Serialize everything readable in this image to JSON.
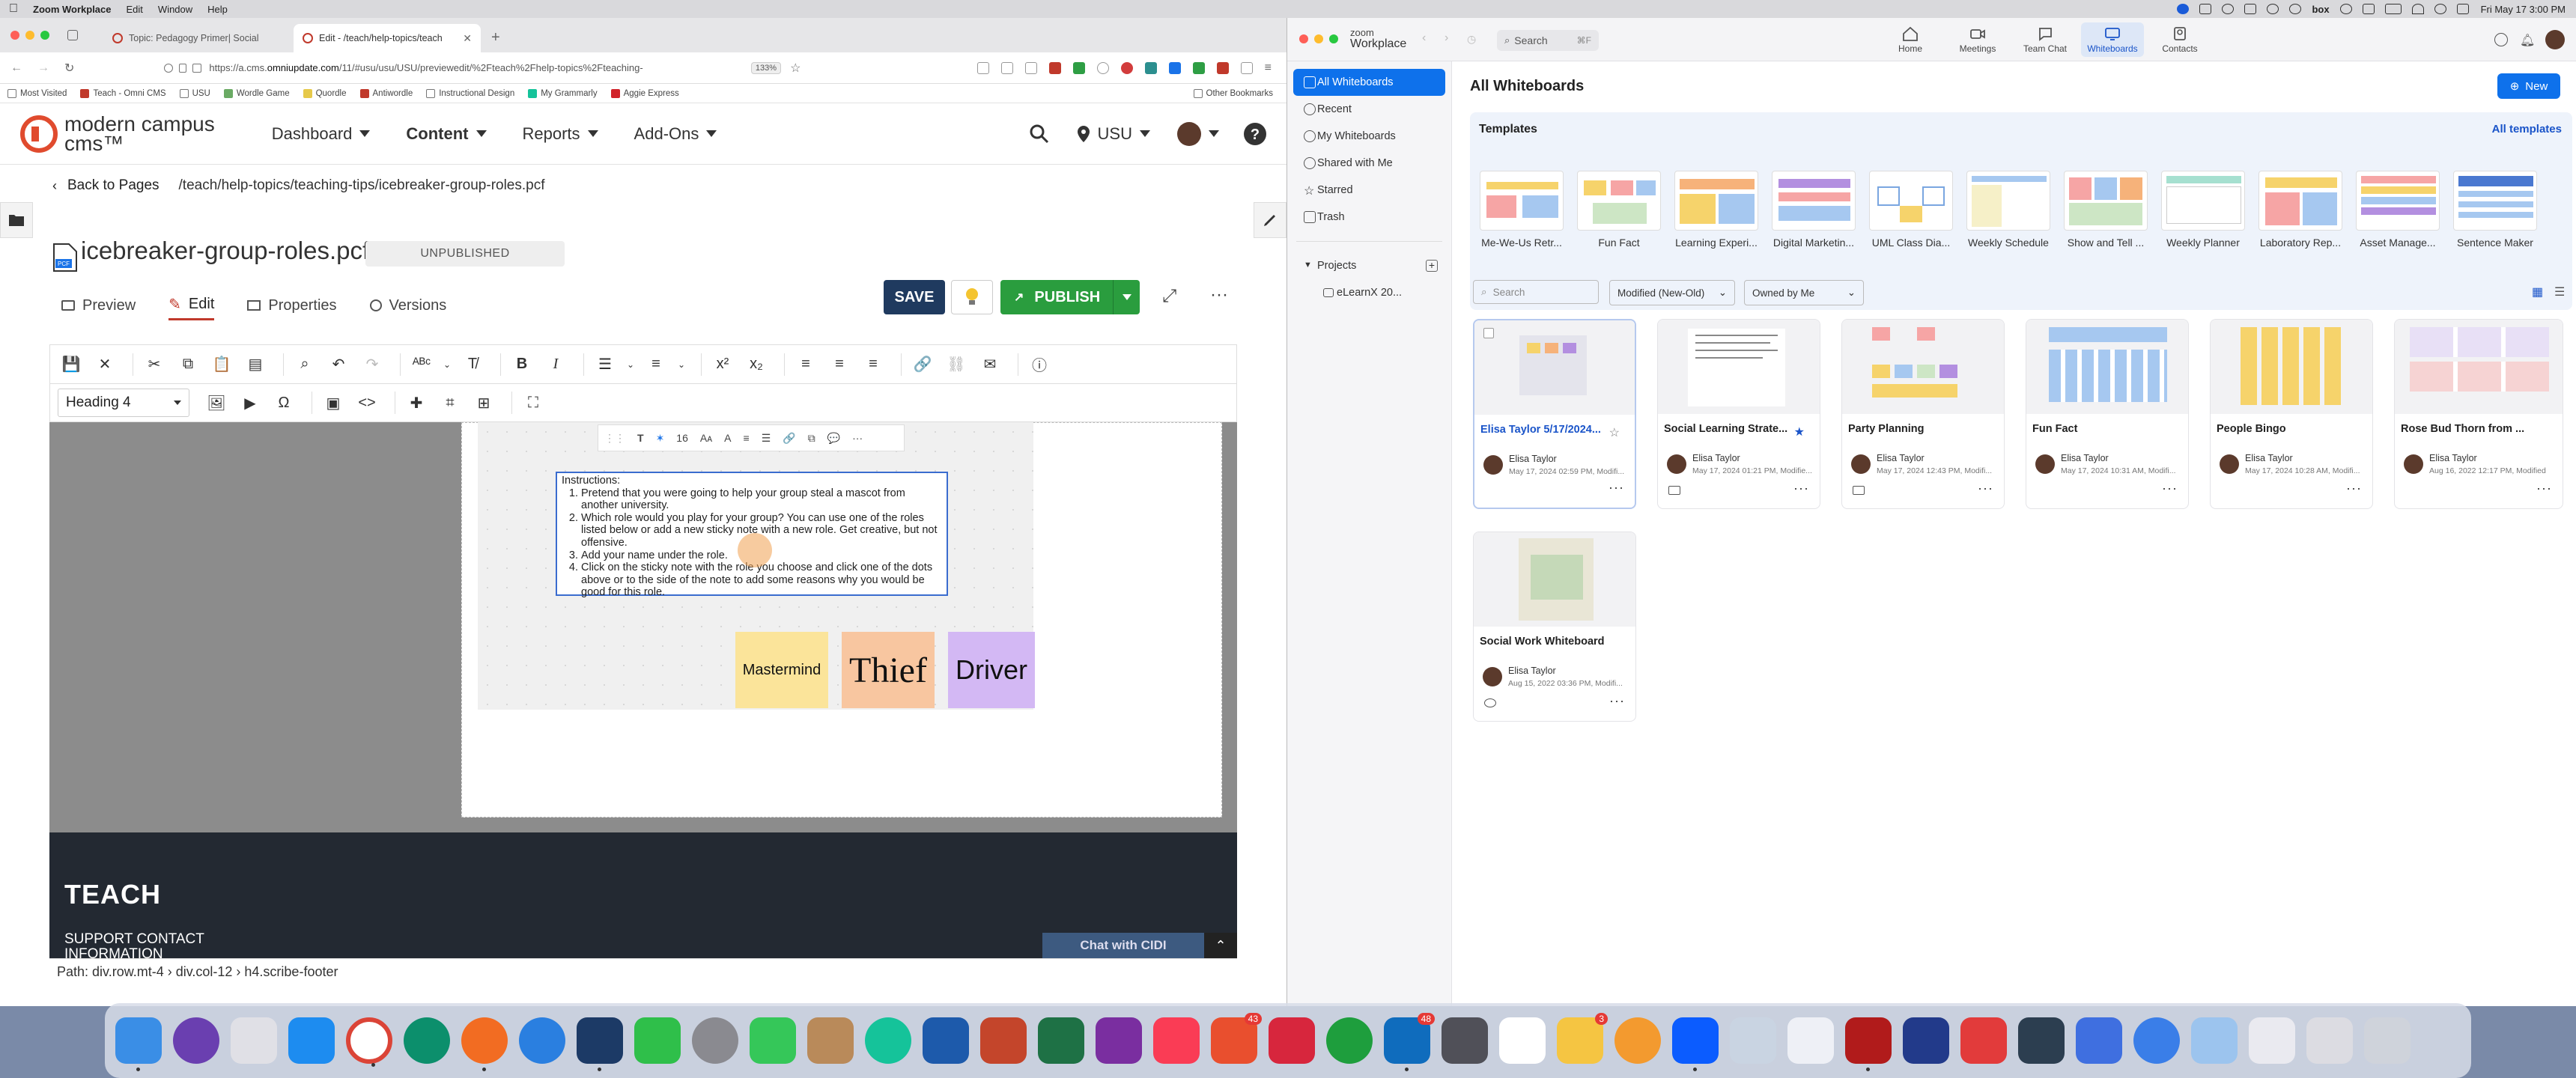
{
  "menubar": {
    "app_name": "Zoom Workplace",
    "items": [
      "Edit",
      "Window",
      "Help"
    ],
    "clock": "Fri May 17  3:00 PM"
  },
  "browser": {
    "tabs": [
      {
        "title": "Topic: Pedagogy Primer| Social"
      },
      {
        "title": "Edit - /teach/help-topics/teach"
      }
    ],
    "url_prefix": "https://a.cms.",
    "url_domain": "omniupdate.com",
    "url_rest": "/11/#usu/usu/USU/previewedit/%2Fteach%2Fhelp-topics%2Fteaching-",
    "zoom": "133%",
    "bookmarks": [
      "Most Visited",
      "Teach - Omni CMS",
      "USU",
      "Wordle Game",
      "Quordle",
      "Antiwordle",
      "Instructional Design",
      "My Grammarly",
      "Aggie Express"
    ],
    "other_bookmarks": "Other Bookmarks"
  },
  "cms": {
    "logo_line1": "modern campus",
    "logo_line2": "cms™",
    "nav": [
      "Dashboard",
      "Content",
      "Reports",
      "Add-Ons"
    ],
    "site": "USU",
    "back_label": "Back to Pages",
    "path": "/teach/help-topics/teaching-tips/icebreaker-group-roles.pcf",
    "file_title": "icebreaker-group-roles.pcf",
    "status": "UNPUBLISHED",
    "save_label": "SAVE",
    "publish_label": "PUBLISH",
    "tabs": [
      "Preview",
      "Edit",
      "Properties",
      "Versions"
    ],
    "heading_select": "Heading 4",
    "wb_font_size": "16",
    "instructions_title": "Instructions:",
    "instructions": [
      "Pretend that you were going to help your group steal a mascot from another university.",
      "Which role would you play for your group? You can use one of the roles listed below or add a new sticky note with a new role. Get creative, but not offensive.",
      "Add your name under the role.",
      "Click on the sticky note with the role you choose and click one of the dots above or to the side of the note to add some reasons why you would be good for this role."
    ],
    "stickies": [
      {
        "label": "Mastermind",
        "color": "#fbe49a"
      },
      {
        "label": "Thief",
        "color": "#f8c6a0"
      },
      {
        "label": "Driver",
        "color": "#d3b8f4"
      }
    ],
    "footer_title": "TEACH",
    "footer_line1": "SUPPORT CONTACT",
    "footer_line2": "INFORMATION",
    "chat_label": "Chat with CIDI",
    "path_bar": "Path:  div.row.mt-4  ›  div.col-12  ›  h4.scribe-footer"
  },
  "zoom": {
    "brand_small": "zoom",
    "brand": "Workplace",
    "search_label": "Search",
    "search_shortcut": "⌘F",
    "top_tabs": [
      "Home",
      "Meetings",
      "Team Chat",
      "Whiteboards",
      "Contacts"
    ],
    "sidebar": [
      "All Whiteboards",
      "Recent",
      "My Whiteboards",
      "Shared with Me",
      "Starred",
      "Trash"
    ],
    "projects_label": "Projects",
    "project_item": "eLearnX 20...",
    "page_title": "All Whiteboards",
    "new_label": "New",
    "templates_label": "Templates",
    "all_templates": "All templates",
    "templates": [
      "Me-We-Us Retr...",
      "Fun Fact",
      "Learning Experi...",
      "Digital Marketin...",
      "UML Class Dia...",
      "Weekly Schedule",
      "Show and Tell ...",
      "Weekly Planner",
      "Laboratory Rep...",
      "Asset Manage...",
      "Sentence Maker"
    ],
    "search_placeholder": "Search",
    "sort_select": "Modified (New-Old)",
    "owner_select": "Owned by Me",
    "whiteboards": [
      {
        "title": "Elisa Taylor 5/17/2024...",
        "owner": "Elisa Taylor",
        "date": "May 17, 2024 02:59 PM, Modifi..."
      },
      {
        "title": "Social Learning Strate...",
        "owner": "Elisa Taylor",
        "date": "May 17, 2024 01:21 PM, Modifie..."
      },
      {
        "title": "Party Planning",
        "owner": "Elisa Taylor",
        "date": "May 17, 2024 12:43 PM, Modifi..."
      },
      {
        "title": "Fun Fact",
        "owner": "Elisa Taylor",
        "date": "May 17, 2024 10:31 AM, Modifi..."
      },
      {
        "title": "People Bingo",
        "owner": "Elisa Taylor",
        "date": "May 17, 2024 10:28 AM, Modifi..."
      },
      {
        "title": "Rose Bud Thorn from ...",
        "owner": "Elisa Taylor",
        "date": "Aug 16, 2022 12:17 PM, Modified"
      },
      {
        "title": "Social Work Whiteboard",
        "owner": "Elisa Taylor",
        "date": "Aug 15, 2022 03:36 PM, Modifi..."
      }
    ],
    "more": "···"
  },
  "dock": {
    "badges": [
      "43",
      "48",
      "3"
    ]
  }
}
